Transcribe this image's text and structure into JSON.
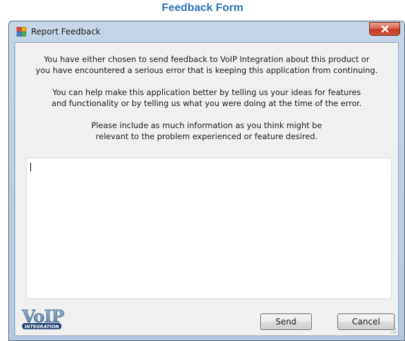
{
  "page": {
    "heading": "Feedback Form"
  },
  "window": {
    "title": "Report Feedback",
    "icon": "application-icon",
    "close_icon": "close-icon"
  },
  "intro": {
    "paragraph1_line1": "You have either chosen to send feedback to VoIP Integration about this product or",
    "paragraph1_line2": "you have encountered a serious error that is keeping this application from continuing.",
    "paragraph2_line1": "You can help make this application better by telling us your ideas for features",
    "paragraph2_line2": "and functionality or by telling us what you were doing at the time of the error.",
    "paragraph3_line1": "Please include as much information as you think might be",
    "paragraph3_line2": "relevant to the problem experienced or feature desired."
  },
  "feedback_input": {
    "value": ""
  },
  "logo": {
    "name": "VoIP",
    "tagline": "INTEGRATION"
  },
  "buttons": {
    "send": "Send",
    "cancel": "Cancel"
  },
  "colors": {
    "heading": "#2e74b5",
    "titlebar": "#c6d6e8",
    "close_button": "#c94a32",
    "client_area": "#f0f0f0",
    "logo_blue": "#6f8fb3",
    "logo_dark": "#1f3f73"
  }
}
